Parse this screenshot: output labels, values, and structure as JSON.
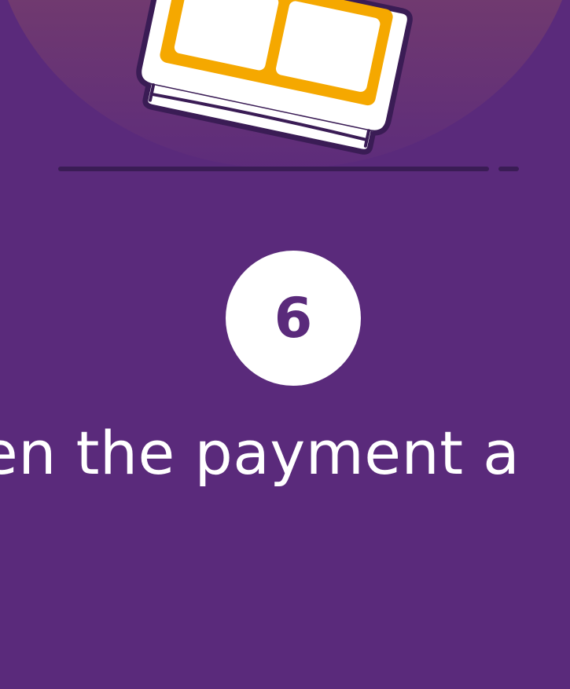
{
  "illustration": {
    "icon": "receipt-card-icon",
    "colors": {
      "background": "#5a2a7b",
      "halo_top": "#8a4a62",
      "card_outline": "#3a1c55",
      "card_accent": "#f5a800",
      "card_fill": "#ffffff"
    }
  },
  "step": {
    "number": "6"
  },
  "caption": {
    "text": "en the payment a"
  }
}
